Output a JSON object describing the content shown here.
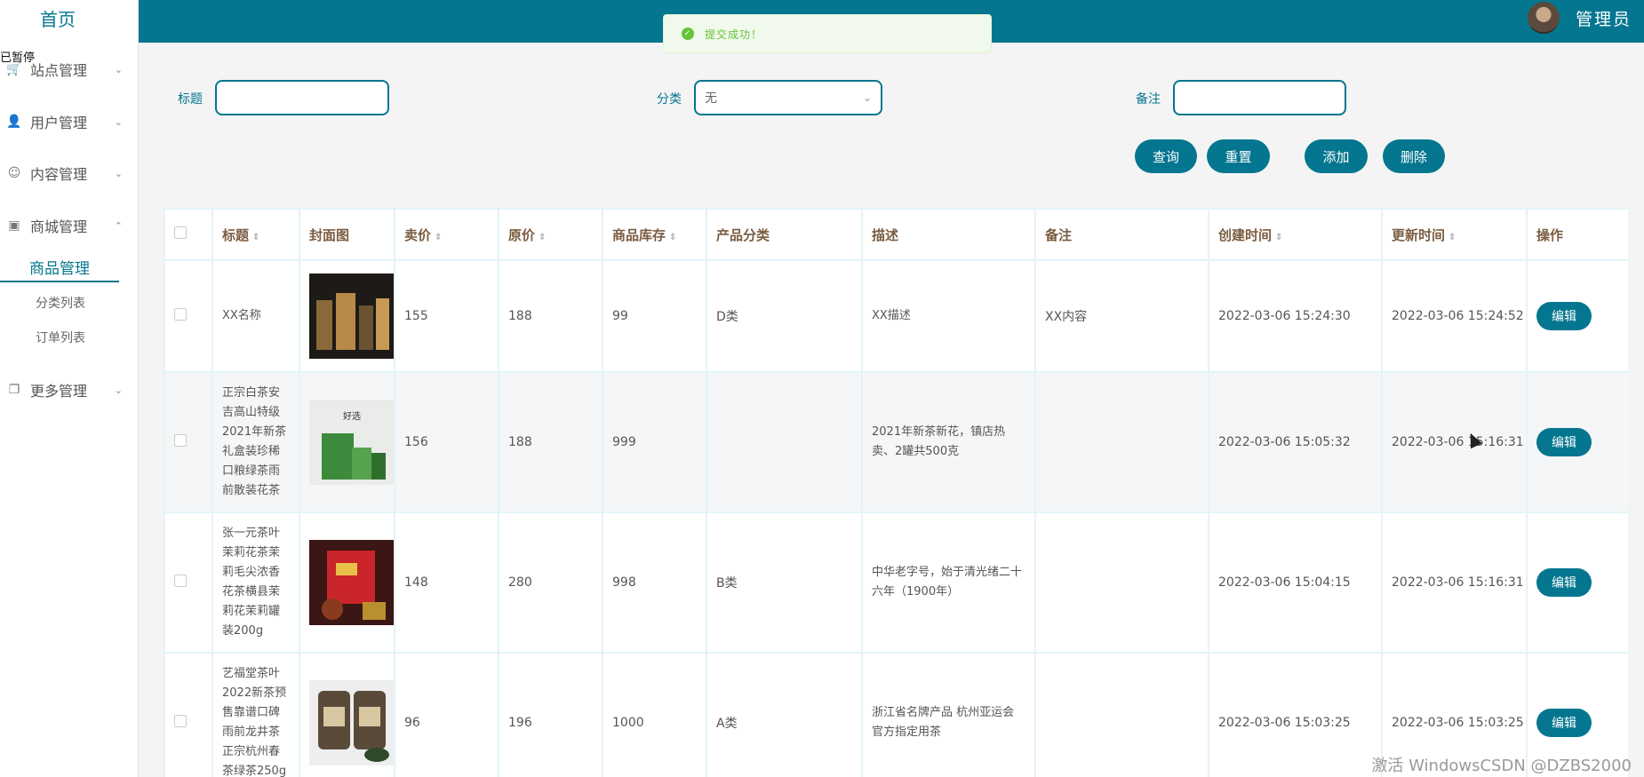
{
  "header": {
    "admin_label": "管理员"
  },
  "toast": {
    "message": "提交成功！"
  },
  "sidebar": {
    "home": "首页",
    "overlay": "已暂停",
    "items": [
      {
        "label": "站点管理"
      },
      {
        "label": "用户管理"
      },
      {
        "label": "内容管理"
      },
      {
        "label": "商城管理"
      },
      {
        "label": "更多管理"
      }
    ],
    "submenu": {
      "active": "商品管理",
      "items": [
        "分类列表",
        "订单列表"
      ]
    }
  },
  "filters": {
    "title_label": "标题",
    "category_label": "分类",
    "category_value": "无",
    "remark_label": "备注"
  },
  "buttons": {
    "query": "查询",
    "reset": "重置",
    "add": "添加",
    "delete": "删除"
  },
  "table": {
    "headers": [
      "标题",
      "封面图",
      "卖价",
      "原价",
      "商品库存",
      "产品分类",
      "描述",
      "备注",
      "创建时间",
      "更新时间",
      "操作"
    ],
    "edit_label": "编辑",
    "rows": [
      {
        "title": "XX名称",
        "price": "155",
        "original": "188",
        "stock": "99",
        "category": "D类",
        "desc": "XX描述",
        "remark": "XX内容",
        "created": "2022-03-06 15:24:30",
        "updated": "2022-03-06 15:24:52"
      },
      {
        "title": "正宗白茶安吉高山特级2021年新茶礼盒装珍稀口粮绿茶雨前散装花茶",
        "price": "156",
        "original": "188",
        "stock": "999",
        "category": "",
        "desc": "2021年新茶新花，镇店热卖、2罐共500克",
        "remark": "",
        "created": "2022-03-06 15:05:32",
        "updated": "2022-03-06 15:16:31"
      },
      {
        "title": "张一元茶叶茉莉花茶茉莉毛尖浓香花茶横县茉莉花茉莉罐装200g",
        "price": "148",
        "original": "280",
        "stock": "998",
        "category": "B类",
        "desc": "中华老字号，始于清光绪二十六年（1900年）",
        "remark": "",
        "created": "2022-03-06 15:04:15",
        "updated": "2022-03-06 15:16:31"
      },
      {
        "title": "艺福堂茶叶2022新茶预售靠谱口碑雨前龙井茶正宗杭州春茶绿茶250g",
        "price": "96",
        "original": "196",
        "stock": "1000",
        "category": "A类",
        "desc": "浙江省名牌产品 杭州亚运会官方指定用茶",
        "remark": "",
        "created": "2022-03-06 15:03:25",
        "updated": "2022-03-06 15:03:25"
      }
    ]
  },
  "watermark": "激活 WindowsCSDN @DZBS2000"
}
